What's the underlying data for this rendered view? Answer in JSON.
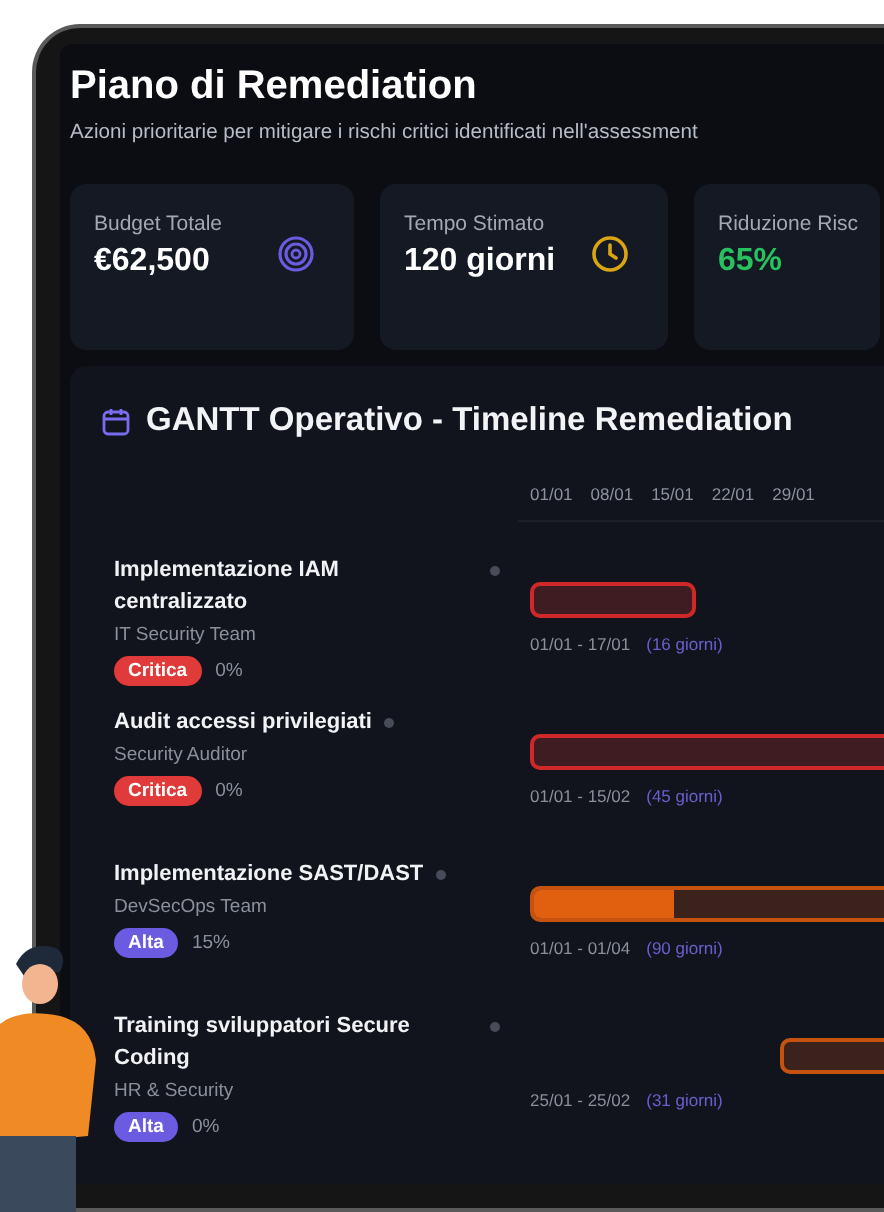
{
  "header": {
    "title": "Piano di Remediation",
    "subtitle": "Azioni prioritarie per mitigare i rischi critici identificati nell'assessment"
  },
  "stats": [
    {
      "kind": "budget",
      "label": "Budget Totale",
      "value": "€62,500"
    },
    {
      "kind": "time",
      "label": "Tempo Stimato",
      "value": "120 giorni"
    },
    {
      "kind": "reduction",
      "label": "Riduzione Risc",
      "value": "65%"
    }
  ],
  "gantt": {
    "title": "GANTT Operativo - Timeline Remediation",
    "dates": [
      "01/01",
      "08/01",
      "15/01",
      "22/01",
      "29/01"
    ],
    "tasks": [
      {
        "name": "Implementazione IAM centralizzato",
        "team": "IT Security Team",
        "kind": "critical",
        "priority_label": "Critica",
        "progress": "0%",
        "range": "01/01 - 17/01",
        "duration": "(16 giorni)"
      },
      {
        "name": "Audit accessi privilegiati",
        "team": "Security Auditor",
        "kind": "critical",
        "priority_label": "Critica",
        "progress": "0%",
        "range": "01/01 - 15/02",
        "duration": "(45 giorni)"
      },
      {
        "name": "Implementazione SAST/DAST",
        "team": "DevSecOps Team",
        "kind": "high",
        "priority_label": "Alta",
        "progress": "15%",
        "level": 0.15,
        "range": "01/01 - 01/04",
        "duration": "(90 giorni)"
      },
      {
        "name": "Training sviluppatori Secure Coding",
        "team": "HR & Security",
        "kind": "high",
        "priority_label": "Alta",
        "progress": "0%",
        "range": "25/01 - 25/02",
        "duration": "(31 giorni)"
      }
    ]
  }
}
